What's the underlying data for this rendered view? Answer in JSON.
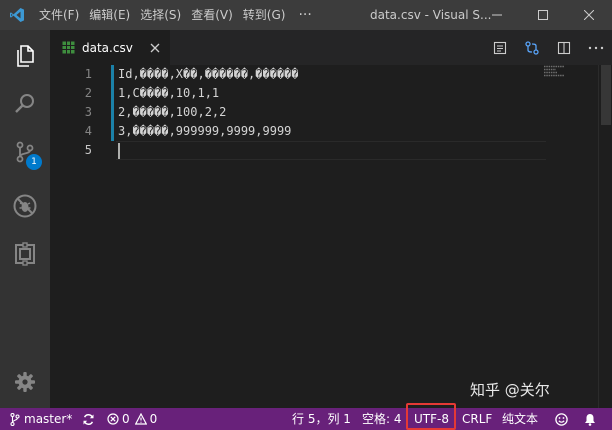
{
  "titlebar": {
    "menu": [
      "文件(F)",
      "编辑(E)",
      "选择(S)",
      "查看(V)",
      "转到(G)"
    ],
    "more": "···",
    "title": "data.csv - Visual S..."
  },
  "activitybar": {
    "icons": [
      "explorer-icon",
      "search-icon",
      "source-control-icon",
      "debug-icon",
      "extensions-icon",
      "gear-icon"
    ],
    "scm_badge": "1"
  },
  "tab": {
    "label": "data.csv"
  },
  "editor": {
    "line_numbers": [
      "1",
      "2",
      "3",
      "4",
      "5"
    ],
    "lines": [
      "Id,����,X��,������,������",
      "1,C����,10,1,1",
      "2,�����,100,2,2",
      "3,�����,999999,9999,9999",
      ""
    ]
  },
  "watermark": "知乎 @关尔",
  "statusbar": {
    "branch": "master*",
    "errors": "0",
    "warnings": "0",
    "position": "行 5，列 1",
    "spaces": "空格: 4",
    "encoding": "UTF-8",
    "eol": "CRLF",
    "language": "纯文本"
  },
  "colors": {
    "statusbar": "#68217a",
    "activitybar": "#333333",
    "editor_bg": "#1e1e1e",
    "highlight": "#e53935"
  }
}
